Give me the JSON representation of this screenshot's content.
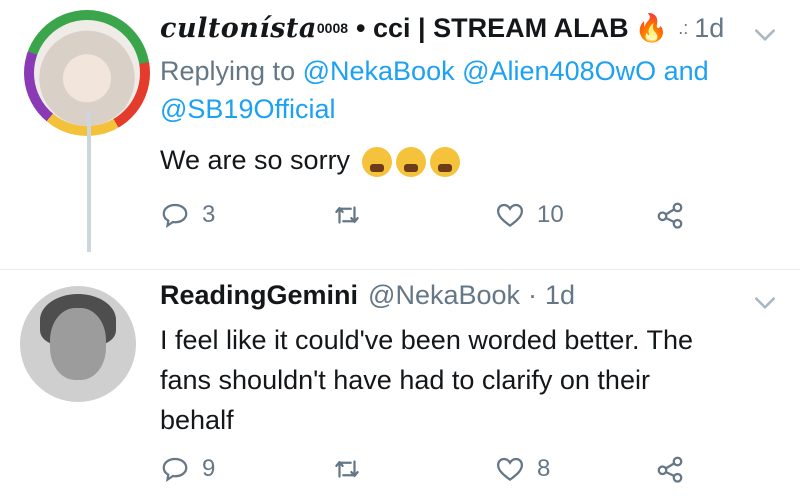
{
  "tweet1": {
    "display_name": "cultonísta",
    "display_name_sup": "0008",
    "display_name_rest": "• cci | STREAM ALAB",
    "fire_emoji": "🔥",
    "dots": ".:",
    "time": "1d",
    "replying_prefix": "Replying to",
    "replying_handle_1": "@NekaBook",
    "replying_handle_2": "@Alien408OwO",
    "replying_and": "and",
    "replying_handle_3": "@SB19Official",
    "text": "We are so sorry",
    "reply_count": "3",
    "retweet_count": "",
    "like_count": "10"
  },
  "tweet2": {
    "display_name": "ReadingGemini",
    "handle": "@NekaBook",
    "dot": "·",
    "time": "1d",
    "text_line_1": "I feel like it could've been worded better. The",
    "text_line_2": "fans shouldn't have had to clarify on their",
    "text_line_3": "behalf",
    "reply_count": "9",
    "retweet_count": "",
    "like_count": "8"
  },
  "colors": {
    "link": "#1da1f2",
    "meta": "#657786",
    "text": "#14171a",
    "thread": "#ccd6dd"
  }
}
